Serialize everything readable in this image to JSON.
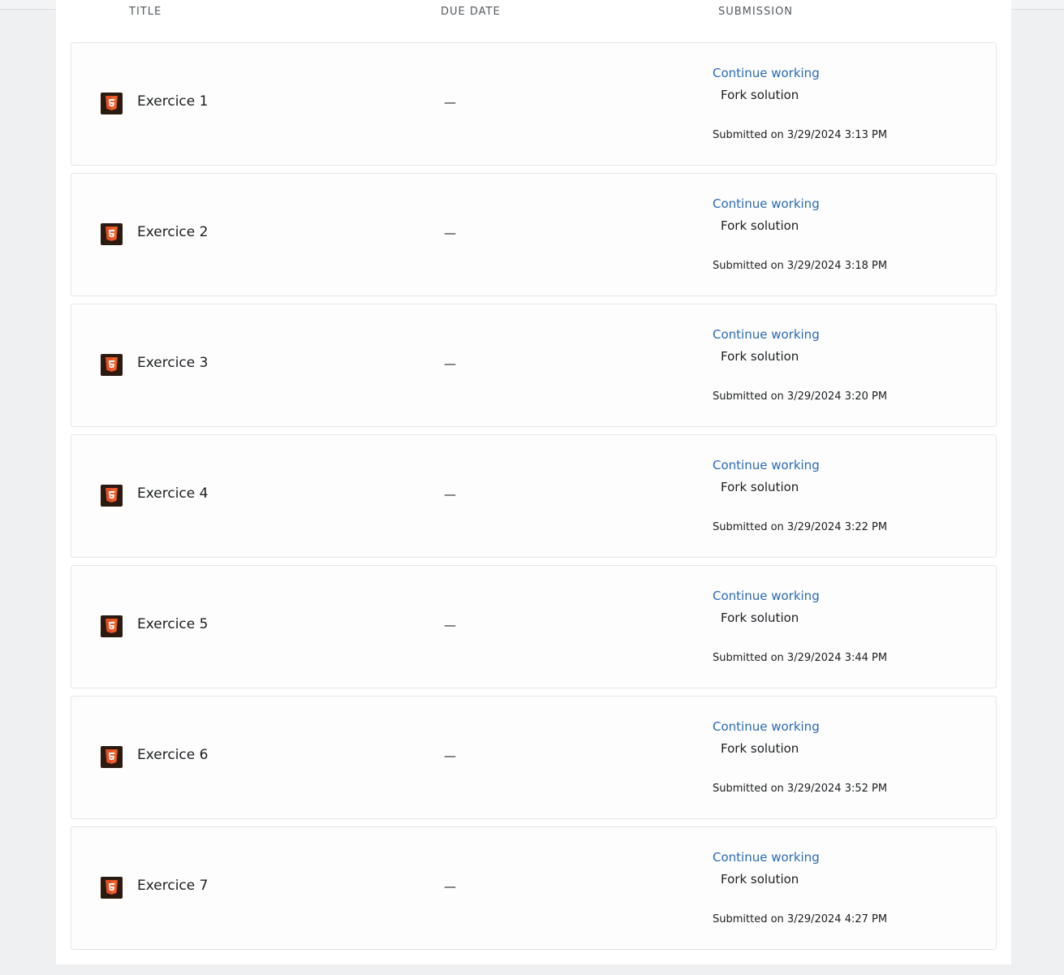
{
  "table": {
    "headers": {
      "title": "TITLE",
      "due_date": "DUE DATE",
      "submission": "SUBMISSION"
    },
    "assignments": [
      {
        "icon": "html5-icon",
        "title": "Exercice 1",
        "due": "—",
        "continue_label": "Continue working",
        "fork_label": "Fork solution",
        "submitted": "Submitted on 3/29/2024 3:13 PM"
      },
      {
        "icon": "html5-icon",
        "title": "Exercice 2",
        "due": "—",
        "continue_label": "Continue working",
        "fork_label": "Fork solution",
        "submitted": "Submitted on 3/29/2024 3:18 PM"
      },
      {
        "icon": "html5-icon",
        "title": "Exercice 3",
        "due": "—",
        "continue_label": "Continue working",
        "fork_label": "Fork solution",
        "submitted": "Submitted on 3/29/2024 3:20 PM"
      },
      {
        "icon": "html5-icon",
        "title": "Exercice 4",
        "due": "—",
        "continue_label": "Continue working",
        "fork_label": "Fork solution",
        "submitted": "Submitted on 3/29/2024 3:22 PM"
      },
      {
        "icon": "html5-icon",
        "title": "Exercice 5",
        "due": "—",
        "continue_label": "Continue working",
        "fork_label": "Fork solution",
        "submitted": "Submitted on 3/29/2024 3:44 PM"
      },
      {
        "icon": "html5-icon",
        "title": "Exercice 6",
        "due": "—",
        "continue_label": "Continue working",
        "fork_label": "Fork solution",
        "submitted": "Submitted on 3/29/2024 3:52 PM"
      },
      {
        "icon": "html5-icon",
        "title": "Exercice 7",
        "due": "—",
        "continue_label": "Continue working",
        "fork_label": "Fork solution",
        "submitted": "Submitted on 3/29/2024 4:27 PM"
      }
    ]
  },
  "colors": {
    "link": "#2a6ab3",
    "html5_icon": "#e34f26"
  }
}
